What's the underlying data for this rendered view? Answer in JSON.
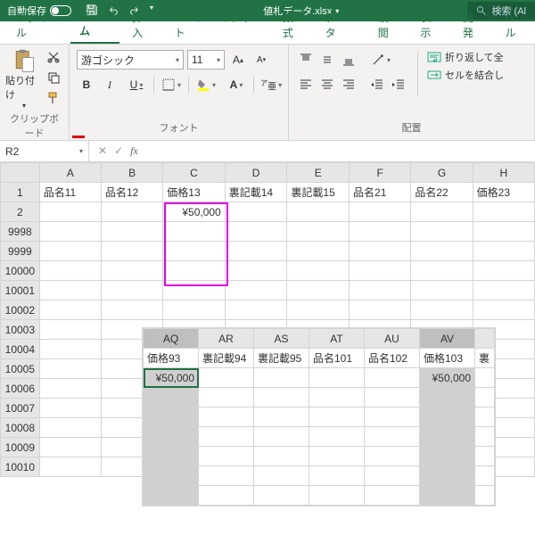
{
  "titlebar": {
    "autosave_label": "自動保存",
    "autosave_state": "オフ",
    "filename": "値札データ.xlsx",
    "search_label": "検索 (Al"
  },
  "tabs": {
    "file": "ファイル",
    "home": "ホーム",
    "insert": "挿入",
    "layout": "ページ レイアウト",
    "formula": "数式",
    "data": "データ",
    "review": "校閲",
    "view": "表示",
    "dev": "開発",
    "help": "ヘル"
  },
  "ribbon": {
    "clipboard": {
      "label": "クリップボード",
      "paste": "貼り付け"
    },
    "font": {
      "label": "フォント",
      "name": "游ゴシック",
      "size": "11",
      "bold": "B",
      "italic": "I",
      "underline": "U"
    },
    "align": {
      "label": "配置",
      "wrap": "折り返して全",
      "merge": "セルを結合し"
    }
  },
  "namebox": {
    "ref": "R2"
  },
  "sheet": {
    "cols": [
      "A",
      "B",
      "C",
      "D",
      "E",
      "F",
      "G",
      "H"
    ],
    "headers": {
      "A": "品名11",
      "B": "品名12",
      "C": "価格13",
      "D": "裏記載14",
      "E": "裏記載15",
      "F": "品名21",
      "G": "品名22",
      "H": "価格23"
    },
    "rows": [
      "1",
      "2",
      "9998",
      "9999",
      "10000",
      "10001",
      "10002",
      "10003",
      "10004",
      "10005",
      "10006",
      "10007",
      "10008",
      "10009",
      "10010"
    ],
    "c2": "¥50,000"
  },
  "float": {
    "cols": [
      "AQ",
      "AR",
      "AS",
      "AT",
      "AU",
      "AV"
    ],
    "headers": {
      "AQ": "価格93",
      "AR": "裏記載94",
      "AS": "裏記載95",
      "AT": "品名101",
      "AU": "品名102",
      "AV": "価格103",
      "AW": "裏"
    },
    "aq_val": "¥50,000",
    "av_val": "¥50,000"
  }
}
